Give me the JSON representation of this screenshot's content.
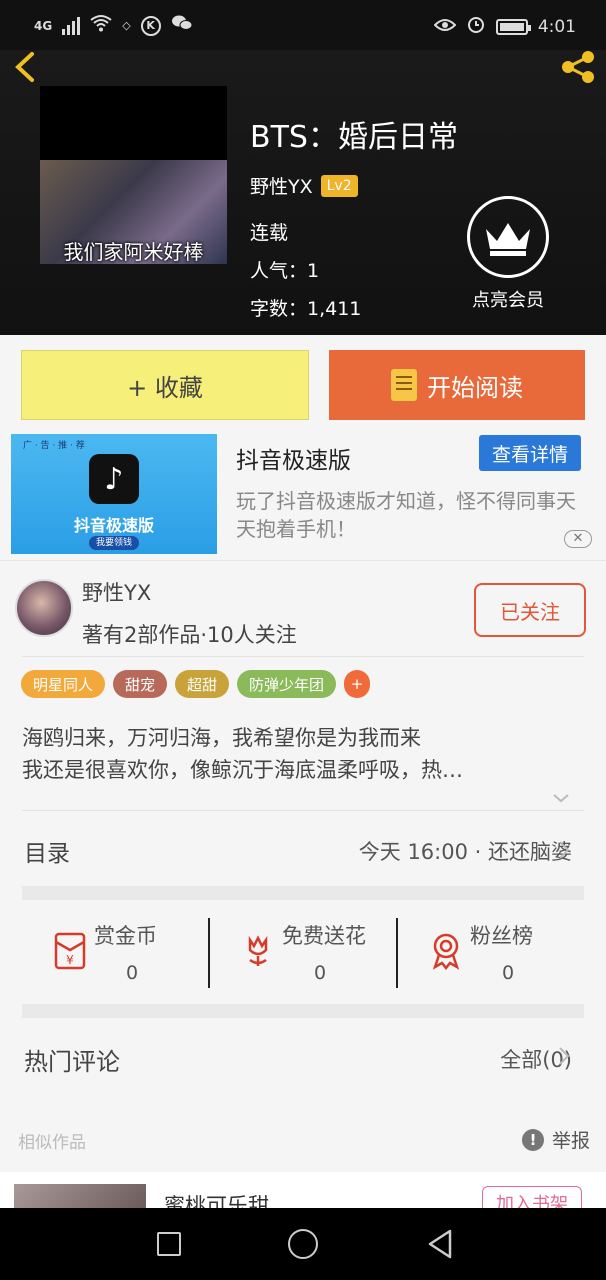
{
  "status_bar": {
    "network": "4G",
    "time": "4:01",
    "k_icon_label": "K"
  },
  "header": {
    "book_title": "BTS：婚后日常",
    "cover_caption": "我们家阿米好棒",
    "author": "野性YX",
    "author_level": "Lv2",
    "status": "连载",
    "popularity": "人气：1",
    "word_count": "字数：1,411",
    "member_label": "点亮会员"
  },
  "actions": {
    "collect_label": "+ 收藏",
    "read_label": "开始阅读"
  },
  "ad": {
    "image_topline": "广 · 告 · 推 · 荐",
    "app_name": "抖音极速版",
    "image_button": "我要领钱",
    "title": "抖音极速版",
    "button_label": "查看详情",
    "description": "玩了抖音极速版才知道，怪不得同事天天抱着手机！",
    "close_label": "✕"
  },
  "author_section": {
    "name": "野性YX",
    "stats": "著有2部作品·10人关注",
    "follow_label": "已关注"
  },
  "tags": [
    {
      "label": "明星同人",
      "color": "#f0a93a"
    },
    {
      "label": "甜宠",
      "color": "#b86a5a"
    },
    {
      "label": "超甜",
      "color": "#c9a23a"
    },
    {
      "label": "防弹少年团",
      "color": "#8aba5a"
    },
    {
      "label": "+",
      "color": "#f06a3a"
    }
  ],
  "description": {
    "line1": "海鸥归来，万河归海，我希望你是为我而来",
    "line2": "我还是很喜欢你，像鲸沉于海底温柔呼吸，热…"
  },
  "toc": {
    "label": "目录",
    "latest": "今天 16:00 · 还还脑婆"
  },
  "stats": {
    "gold": {
      "label": "赏金币",
      "value": "0"
    },
    "flower": {
      "label": "免费送花",
      "value": "0"
    },
    "fans": {
      "label": "粉丝榜",
      "value": "0"
    }
  },
  "comments": {
    "label": "热门评论",
    "all_label": "全部(0)"
  },
  "similar": {
    "label": "相似作品",
    "report_label": "举报"
  },
  "recommend": {
    "title": "蜜桃可乐甜",
    "button": "加入书架"
  }
}
